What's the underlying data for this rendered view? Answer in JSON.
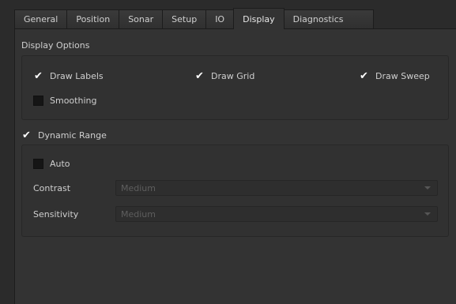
{
  "tabs": [
    {
      "label": "General"
    },
    {
      "label": "Position"
    },
    {
      "label": "Sonar"
    },
    {
      "label": "Setup"
    },
    {
      "label": "IO"
    },
    {
      "label": "Display"
    },
    {
      "label": "Diagnostics"
    }
  ],
  "active_tab": "Display",
  "display_options": {
    "title": "Display Options",
    "draw_labels": {
      "label": "Draw Labels",
      "checked": true
    },
    "draw_grid": {
      "label": "Draw Grid",
      "checked": true
    },
    "draw_sweep": {
      "label": "Draw Sweep",
      "checked": true
    },
    "smoothing": {
      "label": "Smoothing",
      "checked": false
    }
  },
  "dynamic_range": {
    "label": "Dynamic Range",
    "checked": true,
    "auto": {
      "label": "Auto",
      "checked": false
    },
    "contrast": {
      "label": "Contrast",
      "value": "Medium"
    },
    "sensitivity": {
      "label": "Sensitivity",
      "value": "Medium"
    }
  },
  "icons": {
    "checkmark": "✔",
    "dropdown": "chevron-down-icon"
  },
  "colors": {
    "background": "#2b2b2b",
    "panel": "#333333",
    "text": "#cfcfcf",
    "disabled_text": "#5e5e5e"
  }
}
